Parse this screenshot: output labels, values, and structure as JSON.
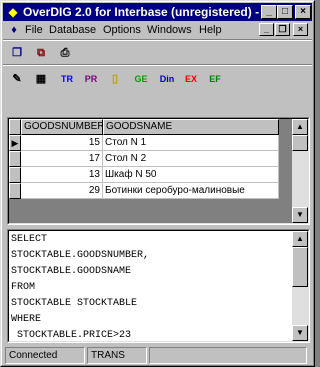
{
  "window": {
    "title": "OverDIG 2.0 for Interbase (unregistered) - [...",
    "controls": {
      "minimize": "_",
      "maximize": "□",
      "close": "×"
    }
  },
  "menu": {
    "items": [
      "File",
      "Database",
      "Options",
      "Windows",
      "Help"
    ],
    "mdi_controls": {
      "minimize": "_",
      "restore": "❐",
      "close": "×"
    }
  },
  "toolbar1": {
    "icons": [
      "copy-window-icon",
      "paste-window-icon",
      "print-icon"
    ]
  },
  "toolbar2": {
    "icons": [
      "speech-icon",
      "table-icon",
      "filter-icon",
      "pr-icon",
      "new-doc-icon",
      "ge-icon",
      "din-icon",
      "ex-icon",
      "ef-icon"
    ],
    "labels": {
      "tr": "TR",
      "pr": "PR",
      "ge": "GE",
      "din": "Din",
      "ex": "EX",
      "ef": "EF"
    }
  },
  "grid": {
    "columns": [
      "GOODSNUMBER",
      "GOODSNAME"
    ],
    "rows": [
      {
        "number": "15",
        "name": "Стол N 1"
      },
      {
        "number": "17",
        "name": "Стол N 2"
      },
      {
        "number": "13",
        "name": "Шкаф N 50"
      },
      {
        "number": "29",
        "name": "Ботинки серобуро-малиновые"
      }
    ]
  },
  "sql": {
    "text": "SELECT\nSTOCKTABLE.GOODSNUMBER,\nSTOCKTABLE.GOODSNAME\nFROM\nSTOCKTABLE STOCKTABLE\nWHERE\n STOCKTABLE.PRICE>23"
  },
  "status": {
    "connection": "Connected",
    "mode": "TRANS",
    "extra": ""
  },
  "colors": {
    "title_bg": "#000080",
    "face": "#c0c0c0",
    "tr": "#0000ff",
    "pr": "#800080",
    "ge": "#00a000",
    "din": "#0000c0",
    "ex": "#ff0000",
    "ef": "#008000"
  }
}
